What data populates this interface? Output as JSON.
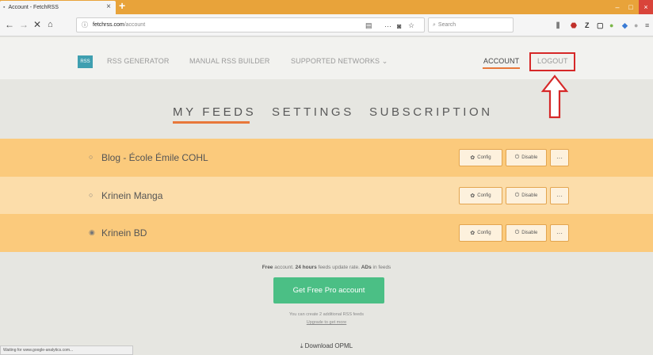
{
  "browser": {
    "tab_title": "Account - FetchRSS",
    "tab_close": "×",
    "new_tab": "+",
    "url_host": "fetchrss.com",
    "url_path": "/account",
    "search_placeholder": "Search",
    "window_min": "–",
    "window_max": "□",
    "window_close": "×",
    "status_text": "Waiting for www.google-analytics.com..."
  },
  "site_nav": {
    "logo_text": "RSS",
    "items": [
      "RSS GENERATOR",
      "MANUAL RSS BUILDER",
      "SUPPORTED NETWORKS ⌄"
    ],
    "account": "ACCOUNT",
    "logout": "LOGOUT"
  },
  "tabs": [
    "MY FEEDS",
    "SETTINGS",
    "SUBSCRIPTION"
  ],
  "feeds": [
    {
      "name": "Blog - École Émile COHL",
      "icon": "○"
    },
    {
      "name": "Krinein Manga",
      "icon": "○"
    },
    {
      "name": "Krinein BD",
      "icon": "◉"
    }
  ],
  "feed_actions": {
    "config": "Config",
    "disable": "Disable",
    "more": "···"
  },
  "account_info": {
    "plan_prefix": "Free",
    "plan_mid": " account. ",
    "rate_bold": "24 hours",
    "rate_text": " feeds update rate. ",
    "ads_bold": "ADs",
    "ads_text": " in feeds",
    "pro_button": "Get Free Pro account",
    "note": "You can create 2 additional RSS feeds",
    "upgrade": "Upgrade to get more",
    "download": "⤓ Download OPML"
  },
  "colors": {
    "accent_orange": "#e8783a",
    "feed_row_dark": "#fbca7c",
    "feed_row_light": "#fcddaa",
    "pro_button": "#4bbf85",
    "annotation_red": "#d62828"
  },
  "icons": {
    "back": "back-arrow-icon",
    "forward": "forward-arrow-icon",
    "stop": "close-icon",
    "home": "home-icon",
    "config": "gear-icon",
    "disable": "power-icon"
  }
}
